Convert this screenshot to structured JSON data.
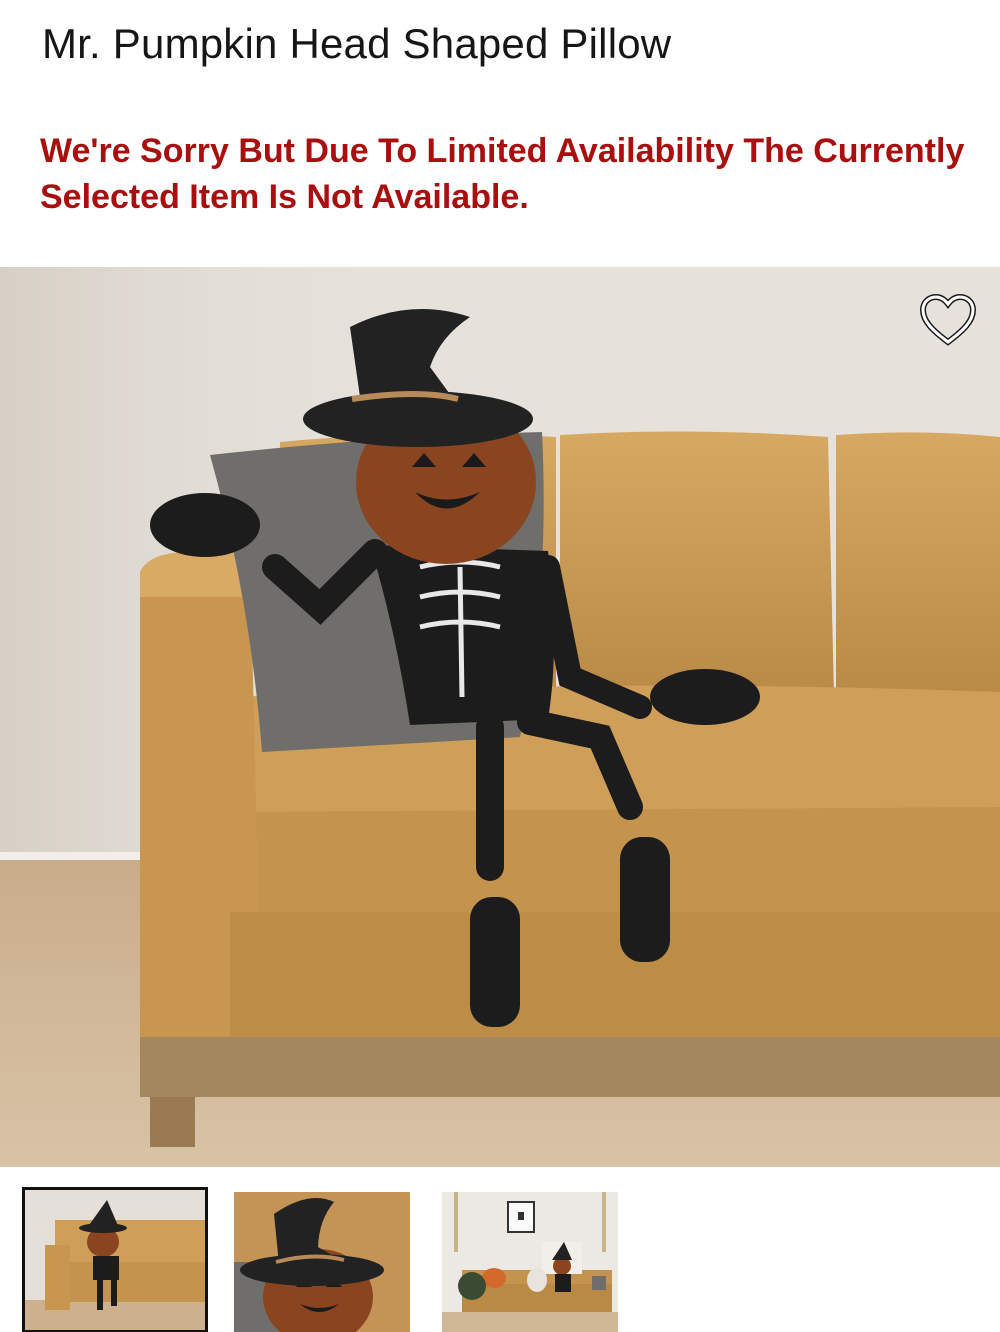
{
  "product": {
    "title": "Mr. Pumpkin Head Shaped Pillow",
    "availability_message": "We're Sorry But Due To Limited Availability The Currently Selected Item Is Not Available."
  },
  "gallery": {
    "main_image": "pumpkin-skeleton-pillow-on-leather-sofa",
    "favorite_icon": "heart-outline-icon",
    "thumbnails": [
      {
        "image": "pumpkin-skeleton-on-sofa-thumbnail",
        "selected": true
      },
      {
        "image": "pumpkin-head-closeup-thumbnail",
        "selected": false
      },
      {
        "image": "halloween-living-room-thumbnail",
        "selected": false
      }
    ]
  },
  "colors": {
    "alert": "#a80f0f",
    "sofa": "#c79a52",
    "wall": "#e4e0d9"
  }
}
